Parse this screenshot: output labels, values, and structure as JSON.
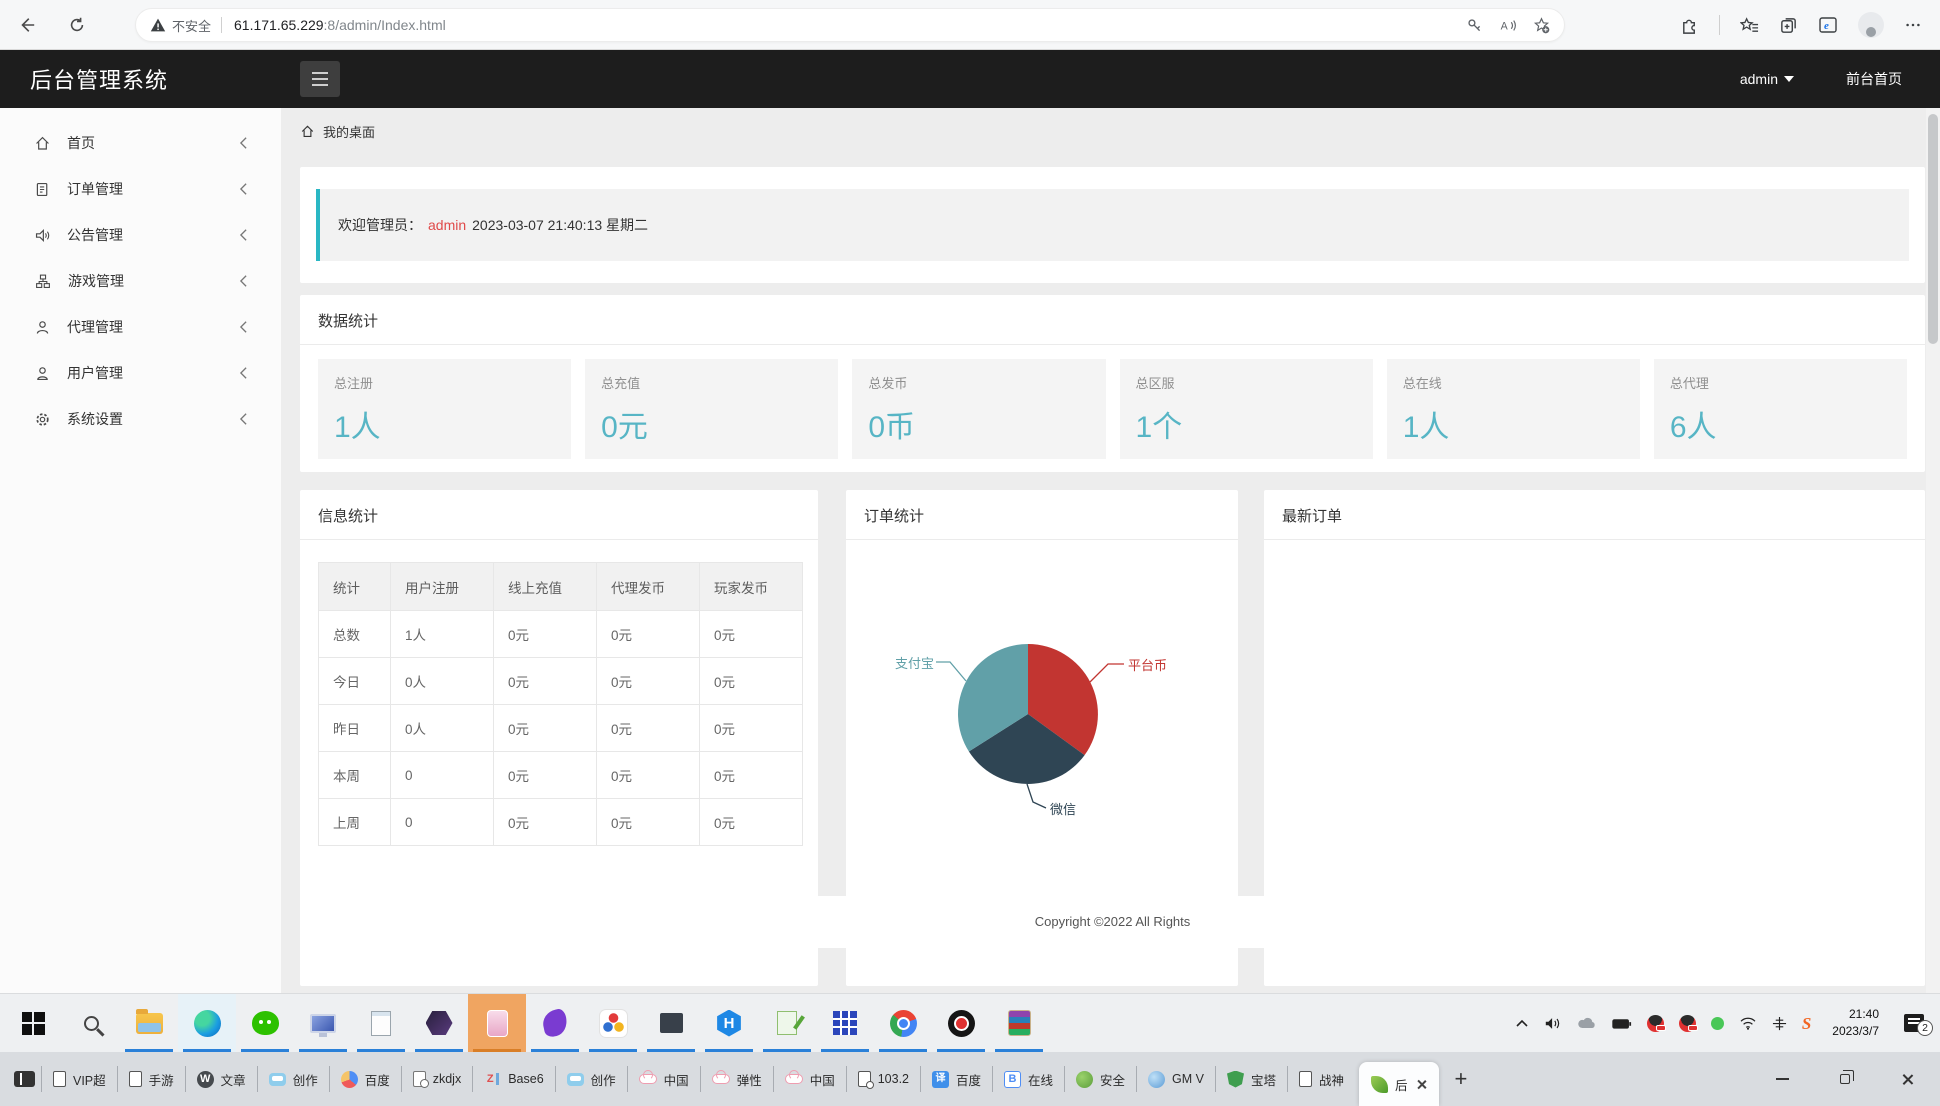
{
  "browser": {
    "security_warning": "不安全",
    "url_host": "61.171.65.229",
    "url_path": ":8/admin/Index.html",
    "toolbar_icons": [
      "back-icon",
      "refresh-icon",
      "warning-icon",
      "password-key-icon",
      "read-aloud-icon",
      "favorite-add-icon",
      "extensions-icon",
      "collections-icon",
      "tab-actions-icon",
      "ie-mode-icon",
      "profile-avatar-icon",
      "more-menu-icon"
    ]
  },
  "header": {
    "title": "后台管理系统",
    "user_menu": "admin",
    "frontend_link": "前台首页"
  },
  "sidebar": {
    "items": [
      {
        "label": "首页",
        "icon": "home"
      },
      {
        "label": "订单管理",
        "icon": "order-doc"
      },
      {
        "label": "公告管理",
        "icon": "announcement"
      },
      {
        "label": "游戏管理",
        "icon": "game-tree"
      },
      {
        "label": "代理管理",
        "icon": "agent-person"
      },
      {
        "label": "用户管理",
        "icon": "user-person"
      },
      {
        "label": "系统设置",
        "icon": "settings-gear"
      }
    ]
  },
  "breadcrumb": {
    "label": "我的桌面"
  },
  "welcome": {
    "prefix": "欢迎管理员：",
    "user": "admin",
    "datetime": "2023-03-07  21:40:13  星期二"
  },
  "stats_panel": {
    "title": "数据统计",
    "cards": [
      {
        "label": "总注册",
        "value": "1人"
      },
      {
        "label": "总充值",
        "value": "0元"
      },
      {
        "label": "总发币",
        "value": "0币"
      },
      {
        "label": "总区服",
        "value": "1个"
      },
      {
        "label": "总在线",
        "value": "1人"
      },
      {
        "label": "总代理",
        "value": "6人"
      }
    ],
    "accent_color": "#57b5c5"
  },
  "info_panel": {
    "title": "信息统计",
    "table": {
      "headers": [
        "统计",
        "用户注册",
        "线上充值",
        "代理发币",
        "玩家发币"
      ],
      "rows": [
        [
          "总数",
          "1人",
          "0元",
          "0元",
          "0元"
        ],
        [
          "今日",
          "0人",
          "0元",
          "0元",
          "0元"
        ],
        [
          "昨日",
          "0人",
          "0元",
          "0元",
          "0元"
        ],
        [
          "本周",
          "0",
          "0元",
          "0元",
          "0元"
        ],
        [
          "上周",
          "0",
          "0元",
          "0元",
          "0元"
        ]
      ]
    }
  },
  "order_stats_panel": {
    "title": "订单统计"
  },
  "chart_data": {
    "type": "pie",
    "title": "订单统计",
    "series": [
      {
        "name": "平台币",
        "value": 35,
        "color": "#c23531"
      },
      {
        "name": "微信",
        "value": 31,
        "color": "#2f4554"
      },
      {
        "name": "支付宝",
        "value": 34,
        "color": "#61a0a8"
      }
    ],
    "unit": "percent_estimate",
    "legend_position": "callout-labels"
  },
  "latest_orders_panel": {
    "title": "最新订单"
  },
  "footer": {
    "copyright": "Copyright ©2022 All Rights"
  },
  "taskbar": {
    "apps": [
      {
        "icon": "start",
        "open": false
      },
      {
        "icon": "search",
        "open": false
      },
      {
        "icon": "explorer",
        "open": true
      },
      {
        "icon": "edge",
        "open": true,
        "highlight": true
      },
      {
        "icon": "wechat",
        "open": true
      },
      {
        "icon": "remote",
        "open": true
      },
      {
        "icon": "notepad",
        "open": true
      },
      {
        "icon": "nox",
        "open": true
      },
      {
        "icon": "phone",
        "open": true,
        "active": true
      },
      {
        "icon": "flame",
        "open": true
      },
      {
        "icon": "trefoil",
        "open": true
      },
      {
        "icon": "winstack",
        "open": true
      },
      {
        "icon": "hbuilder",
        "open": true
      },
      {
        "icon": "npp",
        "open": true
      },
      {
        "icon": "buildings",
        "open": true
      },
      {
        "icon": "chrome",
        "open": true
      },
      {
        "icon": "recorder",
        "open": true
      },
      {
        "icon": "winrar",
        "open": true
      }
    ],
    "tray_icons": [
      "chevron-up",
      "volume",
      "cloud",
      "battery",
      "qq",
      "qq",
      "wechat-status",
      "wifi",
      "ime-cross",
      "sogou"
    ],
    "sogou_letter": "S",
    "time": "21:40",
    "date": "2023/3/7",
    "notification_badge": "2"
  },
  "bottom_tabs": {
    "tabs": [
      {
        "icon": "page",
        "label": "VIP超"
      },
      {
        "icon": "page",
        "label": "手游"
      },
      {
        "icon": "wordpress",
        "letter": "W",
        "label": "文章"
      },
      {
        "icon": "bili",
        "label": "创作"
      },
      {
        "icon": "shield-multi",
        "label": "百度"
      },
      {
        "icon": "gearpage",
        "label": "zkdjx"
      },
      {
        "icon": "zi",
        "letter": "Z",
        "label": "Base6"
      },
      {
        "icon": "bili",
        "label": "创作"
      },
      {
        "icon": "cloud-pink",
        "label": "中国"
      },
      {
        "icon": "cloud-pink",
        "label": "弹性"
      },
      {
        "icon": "cloud-pink",
        "label": "中国"
      },
      {
        "icon": "lockpage",
        "label": "103.2"
      },
      {
        "icon": "trans",
        "letter": "译",
        "label": "百度"
      },
      {
        "icon": "bbox",
        "letter": "B",
        "label": "在线"
      },
      {
        "icon": "bug",
        "label": "安全"
      },
      {
        "icon": "gmv",
        "label": "GM V"
      },
      {
        "icon": "shield-green",
        "label": "宝塔"
      },
      {
        "icon": "page",
        "label": "战神"
      }
    ],
    "active_tab": {
      "icon": "leaf",
      "label": "后"
    },
    "new_tab_glyph": "+"
  }
}
